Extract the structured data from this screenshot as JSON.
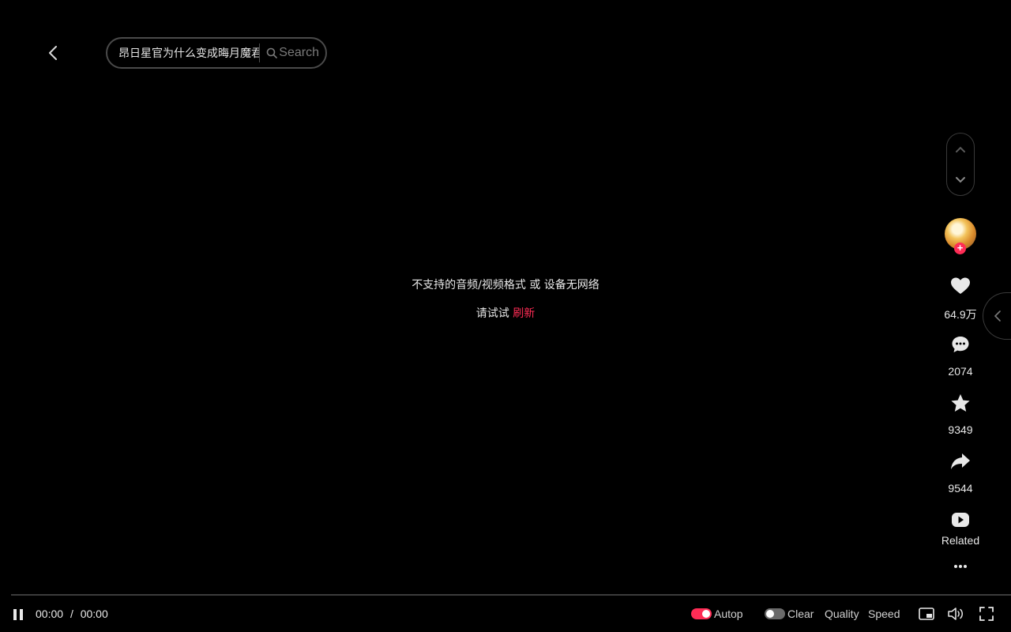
{
  "header": {
    "search": {
      "value": "昂日星官为什么变成晦月魔君",
      "placeholder": "Search"
    },
    "search_button_label": "Search"
  },
  "player": {
    "error_message": "不支持的音频/视频格式 或 设备无网络",
    "retry_prefix": "请试试",
    "refresh_label": "刷新",
    "progress": 0,
    "current_time": "00:00",
    "time_separator": "/",
    "duration": "00:00"
  },
  "sidebar": {
    "like_count": "64.9万",
    "comment_count": "2074",
    "favorite_count": "9349",
    "share_count": "9544",
    "related_label": "Related"
  },
  "controls": {
    "autoplay_label": "Autop",
    "autoplay_on": true,
    "clear_label": "Clear",
    "clear_on": false,
    "quality_label": "Quality",
    "speed_label": "Speed"
  },
  "colors": {
    "accent": "#fe2c55",
    "background": "#000000"
  }
}
